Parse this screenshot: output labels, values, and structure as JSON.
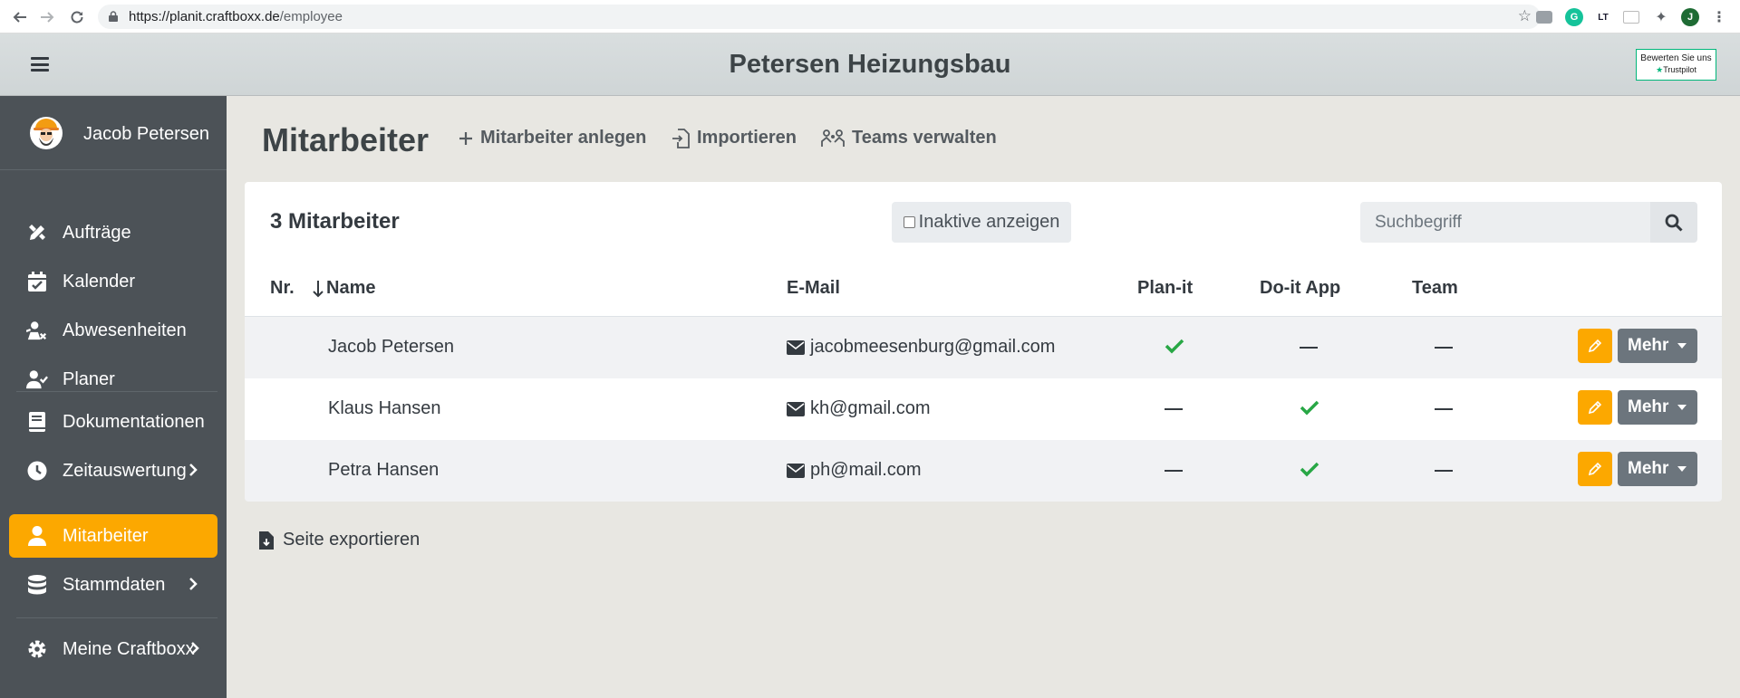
{
  "browser": {
    "url_host": "https://planit.craftboxx.de",
    "url_path": "/employee",
    "profile_initial": "J"
  },
  "header": {
    "company": "Petersen Heizungsbau",
    "trustpilot_line1": "Bewerten Sie uns",
    "trustpilot_line2": "Trustpilot"
  },
  "sidebar": {
    "user_name": "Jacob Petersen",
    "items": [
      {
        "label": "Aufträge",
        "icon": "edit-tools-icon"
      },
      {
        "label": "Kalender",
        "icon": "calendar-check-icon"
      },
      {
        "label": "Abwesenheiten",
        "icon": "user-absent-icon"
      },
      {
        "label": "Planer",
        "icon": "user-check-icon"
      },
      {
        "label": "Dokumentationen",
        "icon": "book-icon"
      },
      {
        "label": "Zeitauswertung",
        "icon": "clock-icon"
      },
      {
        "label": "Mitarbeiter",
        "icon": "user-icon"
      },
      {
        "label": "Stammdaten",
        "icon": "database-icon"
      },
      {
        "label": "Meine Craftboxx",
        "icon": "gear-icon"
      }
    ]
  },
  "main": {
    "title": "Mitarbeiter",
    "actions": {
      "create": "Mitarbeiter anlegen",
      "import": "Importieren",
      "teams": "Teams verwalten"
    },
    "count": "3 Mitarbeiter",
    "inactive_label": "Inaktive anzeigen",
    "search_placeholder": "Suchbegriff",
    "columns": {
      "nr": "Nr.",
      "name": "Name",
      "email": "E-Mail",
      "planit": "Plan-it",
      "doit": "Do-it App",
      "team": "Team"
    },
    "rows": [
      {
        "name": "Jacob Petersen",
        "email": "jacobmeesenburg@gmail.com",
        "planit": true,
        "doit": false,
        "team": "—"
      },
      {
        "name": "Klaus Hansen",
        "email": "kh@gmail.com",
        "planit": false,
        "doit": true,
        "team": "—"
      },
      {
        "name": "Petra Hansen",
        "email": "ph@mail.com",
        "planit": false,
        "doit": true,
        "team": "—"
      }
    ],
    "more_label": "Mehr",
    "export_label": "Seite exportieren"
  },
  "colors": {
    "accent": "#fca800",
    "sidebar": "#4c5257",
    "check": "#28a745"
  }
}
